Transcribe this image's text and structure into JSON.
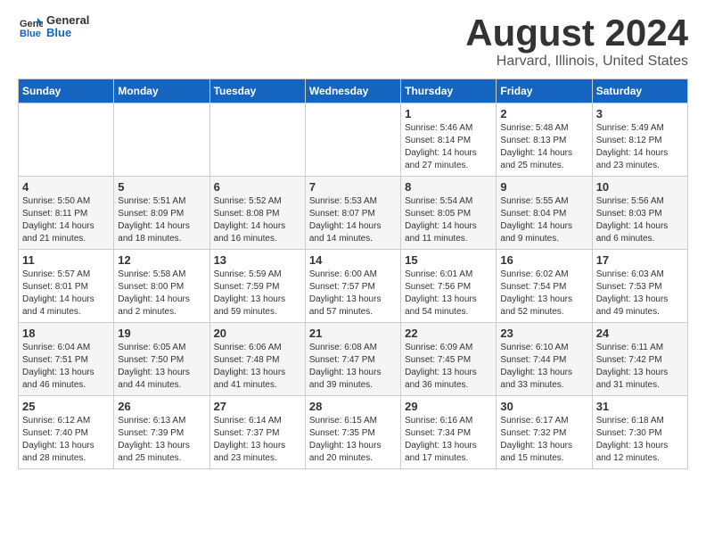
{
  "header": {
    "logo_general": "General",
    "logo_blue": "Blue",
    "month_title": "August 2024",
    "location": "Harvard, Illinois, United States"
  },
  "weekdays": [
    "Sunday",
    "Monday",
    "Tuesday",
    "Wednesday",
    "Thursday",
    "Friday",
    "Saturday"
  ],
  "weeks": [
    [
      {
        "day": "",
        "info": ""
      },
      {
        "day": "",
        "info": ""
      },
      {
        "day": "",
        "info": ""
      },
      {
        "day": "",
        "info": ""
      },
      {
        "day": "1",
        "info": "Sunrise: 5:46 AM\nSunset: 8:14 PM\nDaylight: 14 hours\nand 27 minutes."
      },
      {
        "day": "2",
        "info": "Sunrise: 5:48 AM\nSunset: 8:13 PM\nDaylight: 14 hours\nand 25 minutes."
      },
      {
        "day": "3",
        "info": "Sunrise: 5:49 AM\nSunset: 8:12 PM\nDaylight: 14 hours\nand 23 minutes."
      }
    ],
    [
      {
        "day": "4",
        "info": "Sunrise: 5:50 AM\nSunset: 8:11 PM\nDaylight: 14 hours\nand 21 minutes."
      },
      {
        "day": "5",
        "info": "Sunrise: 5:51 AM\nSunset: 8:09 PM\nDaylight: 14 hours\nand 18 minutes."
      },
      {
        "day": "6",
        "info": "Sunrise: 5:52 AM\nSunset: 8:08 PM\nDaylight: 14 hours\nand 16 minutes."
      },
      {
        "day": "7",
        "info": "Sunrise: 5:53 AM\nSunset: 8:07 PM\nDaylight: 14 hours\nand 14 minutes."
      },
      {
        "day": "8",
        "info": "Sunrise: 5:54 AM\nSunset: 8:05 PM\nDaylight: 14 hours\nand 11 minutes."
      },
      {
        "day": "9",
        "info": "Sunrise: 5:55 AM\nSunset: 8:04 PM\nDaylight: 14 hours\nand 9 minutes."
      },
      {
        "day": "10",
        "info": "Sunrise: 5:56 AM\nSunset: 8:03 PM\nDaylight: 14 hours\nand 6 minutes."
      }
    ],
    [
      {
        "day": "11",
        "info": "Sunrise: 5:57 AM\nSunset: 8:01 PM\nDaylight: 14 hours\nand 4 minutes."
      },
      {
        "day": "12",
        "info": "Sunrise: 5:58 AM\nSunset: 8:00 PM\nDaylight: 14 hours\nand 2 minutes."
      },
      {
        "day": "13",
        "info": "Sunrise: 5:59 AM\nSunset: 7:59 PM\nDaylight: 13 hours\nand 59 minutes."
      },
      {
        "day": "14",
        "info": "Sunrise: 6:00 AM\nSunset: 7:57 PM\nDaylight: 13 hours\nand 57 minutes."
      },
      {
        "day": "15",
        "info": "Sunrise: 6:01 AM\nSunset: 7:56 PM\nDaylight: 13 hours\nand 54 minutes."
      },
      {
        "day": "16",
        "info": "Sunrise: 6:02 AM\nSunset: 7:54 PM\nDaylight: 13 hours\nand 52 minutes."
      },
      {
        "day": "17",
        "info": "Sunrise: 6:03 AM\nSunset: 7:53 PM\nDaylight: 13 hours\nand 49 minutes."
      }
    ],
    [
      {
        "day": "18",
        "info": "Sunrise: 6:04 AM\nSunset: 7:51 PM\nDaylight: 13 hours\nand 46 minutes."
      },
      {
        "day": "19",
        "info": "Sunrise: 6:05 AM\nSunset: 7:50 PM\nDaylight: 13 hours\nand 44 minutes."
      },
      {
        "day": "20",
        "info": "Sunrise: 6:06 AM\nSunset: 7:48 PM\nDaylight: 13 hours\nand 41 minutes."
      },
      {
        "day": "21",
        "info": "Sunrise: 6:08 AM\nSunset: 7:47 PM\nDaylight: 13 hours\nand 39 minutes."
      },
      {
        "day": "22",
        "info": "Sunrise: 6:09 AM\nSunset: 7:45 PM\nDaylight: 13 hours\nand 36 minutes."
      },
      {
        "day": "23",
        "info": "Sunrise: 6:10 AM\nSunset: 7:44 PM\nDaylight: 13 hours\nand 33 minutes."
      },
      {
        "day": "24",
        "info": "Sunrise: 6:11 AM\nSunset: 7:42 PM\nDaylight: 13 hours\nand 31 minutes."
      }
    ],
    [
      {
        "day": "25",
        "info": "Sunrise: 6:12 AM\nSunset: 7:40 PM\nDaylight: 13 hours\nand 28 minutes."
      },
      {
        "day": "26",
        "info": "Sunrise: 6:13 AM\nSunset: 7:39 PM\nDaylight: 13 hours\nand 25 minutes."
      },
      {
        "day": "27",
        "info": "Sunrise: 6:14 AM\nSunset: 7:37 PM\nDaylight: 13 hours\nand 23 minutes."
      },
      {
        "day": "28",
        "info": "Sunrise: 6:15 AM\nSunset: 7:35 PM\nDaylight: 13 hours\nand 20 minutes."
      },
      {
        "day": "29",
        "info": "Sunrise: 6:16 AM\nSunset: 7:34 PM\nDaylight: 13 hours\nand 17 minutes."
      },
      {
        "day": "30",
        "info": "Sunrise: 6:17 AM\nSunset: 7:32 PM\nDaylight: 13 hours\nand 15 minutes."
      },
      {
        "day": "31",
        "info": "Sunrise: 6:18 AM\nSunset: 7:30 PM\nDaylight: 13 hours\nand 12 minutes."
      }
    ]
  ]
}
